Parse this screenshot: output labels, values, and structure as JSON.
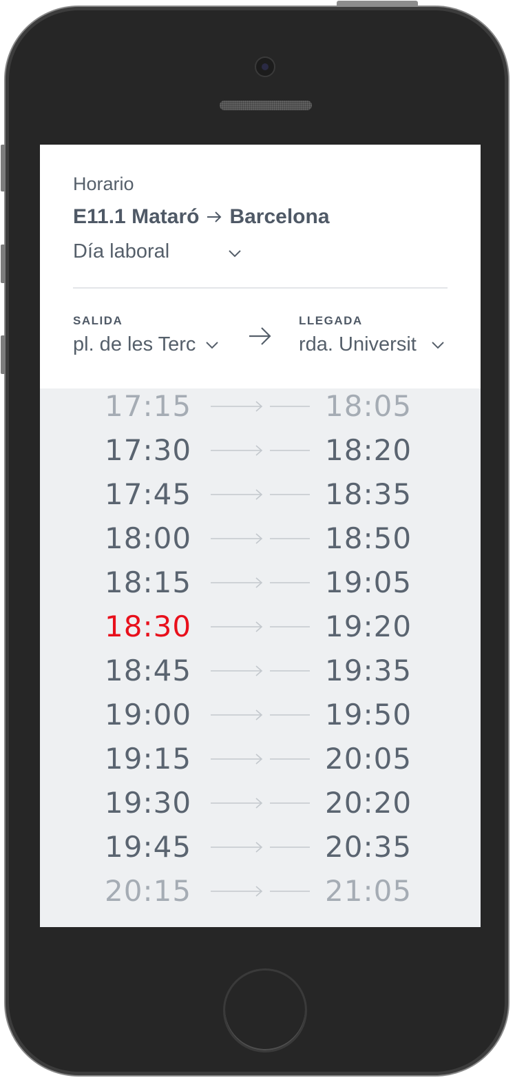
{
  "schedule": {
    "label": "Horario",
    "line": "E11.1",
    "origin": "Mataró",
    "destination": "Barcelona",
    "day_type": "Día laboral"
  },
  "stops": {
    "from_caption": "SALIDA",
    "from_value": "pl. de les Terc",
    "to_caption": "LLEGADA",
    "to_value": "rda. Universit"
  },
  "trips": [
    {
      "departure": "17:15",
      "arrival": "18:05",
      "state": "faded"
    },
    {
      "departure": "17:30",
      "arrival": "18:20",
      "state": "normal"
    },
    {
      "departure": "17:45",
      "arrival": "18:35",
      "state": "normal"
    },
    {
      "departure": "18:00",
      "arrival": "18:50",
      "state": "normal"
    },
    {
      "departure": "18:15",
      "arrival": "19:05",
      "state": "normal"
    },
    {
      "departure": "18:30",
      "arrival": "19:20",
      "state": "current"
    },
    {
      "departure": "18:45",
      "arrival": "19:35",
      "state": "normal"
    },
    {
      "departure": "19:00",
      "arrival": "19:50",
      "state": "normal"
    },
    {
      "departure": "19:15",
      "arrival": "20:05",
      "state": "normal"
    },
    {
      "departure": "19:30",
      "arrival": "20:20",
      "state": "normal"
    },
    {
      "departure": "19:45",
      "arrival": "20:35",
      "state": "normal"
    },
    {
      "departure": "20:15",
      "arrival": "21:05",
      "state": "faded"
    }
  ],
  "colors": {
    "current": "#e8101c",
    "text": "#5a6470",
    "list_background": "#eef0f2"
  }
}
